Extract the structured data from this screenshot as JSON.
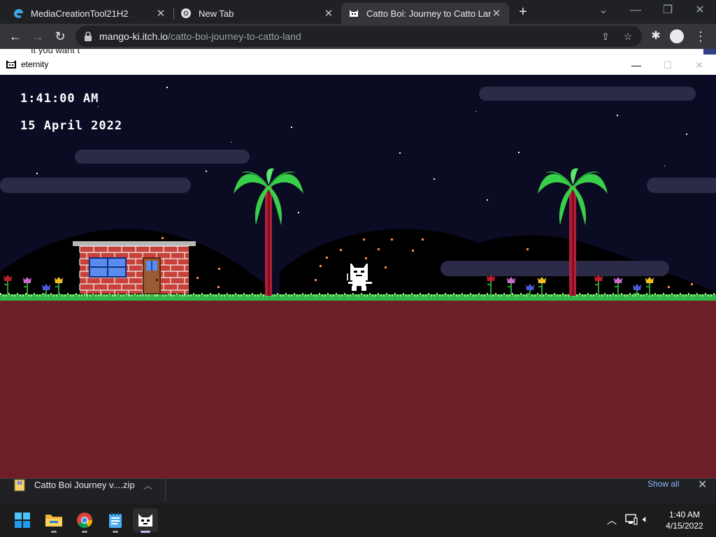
{
  "browser": {
    "tabs": [
      {
        "title": "MediaCreationTool21H2",
        "icon": "edge-icon",
        "active": false
      },
      {
        "title": "New Tab",
        "icon": "chrome-icon",
        "active": false
      },
      {
        "title": "Catto Boi: Journey to Catto Land",
        "icon": "cat-icon",
        "active": true
      }
    ],
    "url_domain": "mango-ki.itch.io",
    "url_path": "/catto-boi-journey-to-catto-land",
    "page_behind_text": "It you want t"
  },
  "game_window": {
    "title": "eternity",
    "hud": {
      "time": "1:41:00 AM",
      "date": "15 April 2022"
    },
    "colors": {
      "sky": "#0b0b24",
      "ground": "#6e1e26",
      "grass": "#2fb548",
      "brick": "#c8413a",
      "palm_leaf": "#39d049",
      "trunk": "#b41e38"
    }
  },
  "downloads": {
    "file_name": "Catto Boi Journey v....zip",
    "show_all": "Show all"
  },
  "taskbar": {
    "apps": [
      "windows-start-icon",
      "file-explorer-icon",
      "chrome-icon",
      "notepad-icon",
      "catto-game-icon"
    ],
    "clock_time": "1:40 AM",
    "clock_date": "4/15/2022"
  }
}
